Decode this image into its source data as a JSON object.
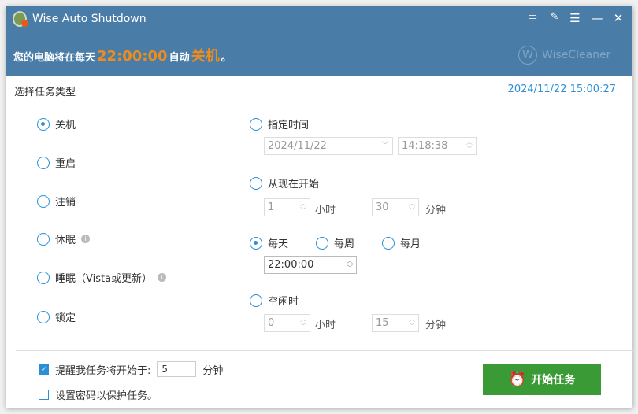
{
  "window": {
    "title": "Wise Auto Shutdown"
  },
  "header": {
    "msg_prefix": "您的电脑将在每天",
    "time": "22:00:00",
    "msg_mid": "自动",
    "action": "关机",
    "msg_end": "。",
    "brand": "WiseCleaner",
    "brand_initial": "W"
  },
  "section_title": "选择任务类型",
  "datetime": "2024/11/22 15:00:27",
  "task_types": [
    {
      "label": "关机",
      "selected": true
    },
    {
      "label": "重启",
      "selected": false
    },
    {
      "label": "注销",
      "selected": false
    },
    {
      "label": "休眠",
      "selected": false,
      "info": true
    },
    {
      "label": "睡眠（Vista或更新）",
      "selected": false,
      "info": true
    },
    {
      "label": "锁定",
      "selected": false
    }
  ],
  "schedule": {
    "specific": {
      "label": "指定时间",
      "date": "2024/11/22",
      "time": "14:18:38"
    },
    "from_now": {
      "label": "从现在开始",
      "hours": "1",
      "minutes": "30"
    },
    "daily": {
      "label": "每天",
      "weekly": "每周",
      "monthly": "每月",
      "time": "22:00:00"
    },
    "idle": {
      "label": "空闲时",
      "hours": "0",
      "minutes": "15"
    },
    "hour_unit": "小时",
    "minute_unit": "分钟"
  },
  "footer": {
    "remind_label": "提醒我任务将开始于:",
    "remind_value": "5",
    "remind_unit": "分钟",
    "remind_checked": true,
    "password_label": "设置密码以保护任务。",
    "password_checked": false,
    "start_button": "开始任务"
  }
}
